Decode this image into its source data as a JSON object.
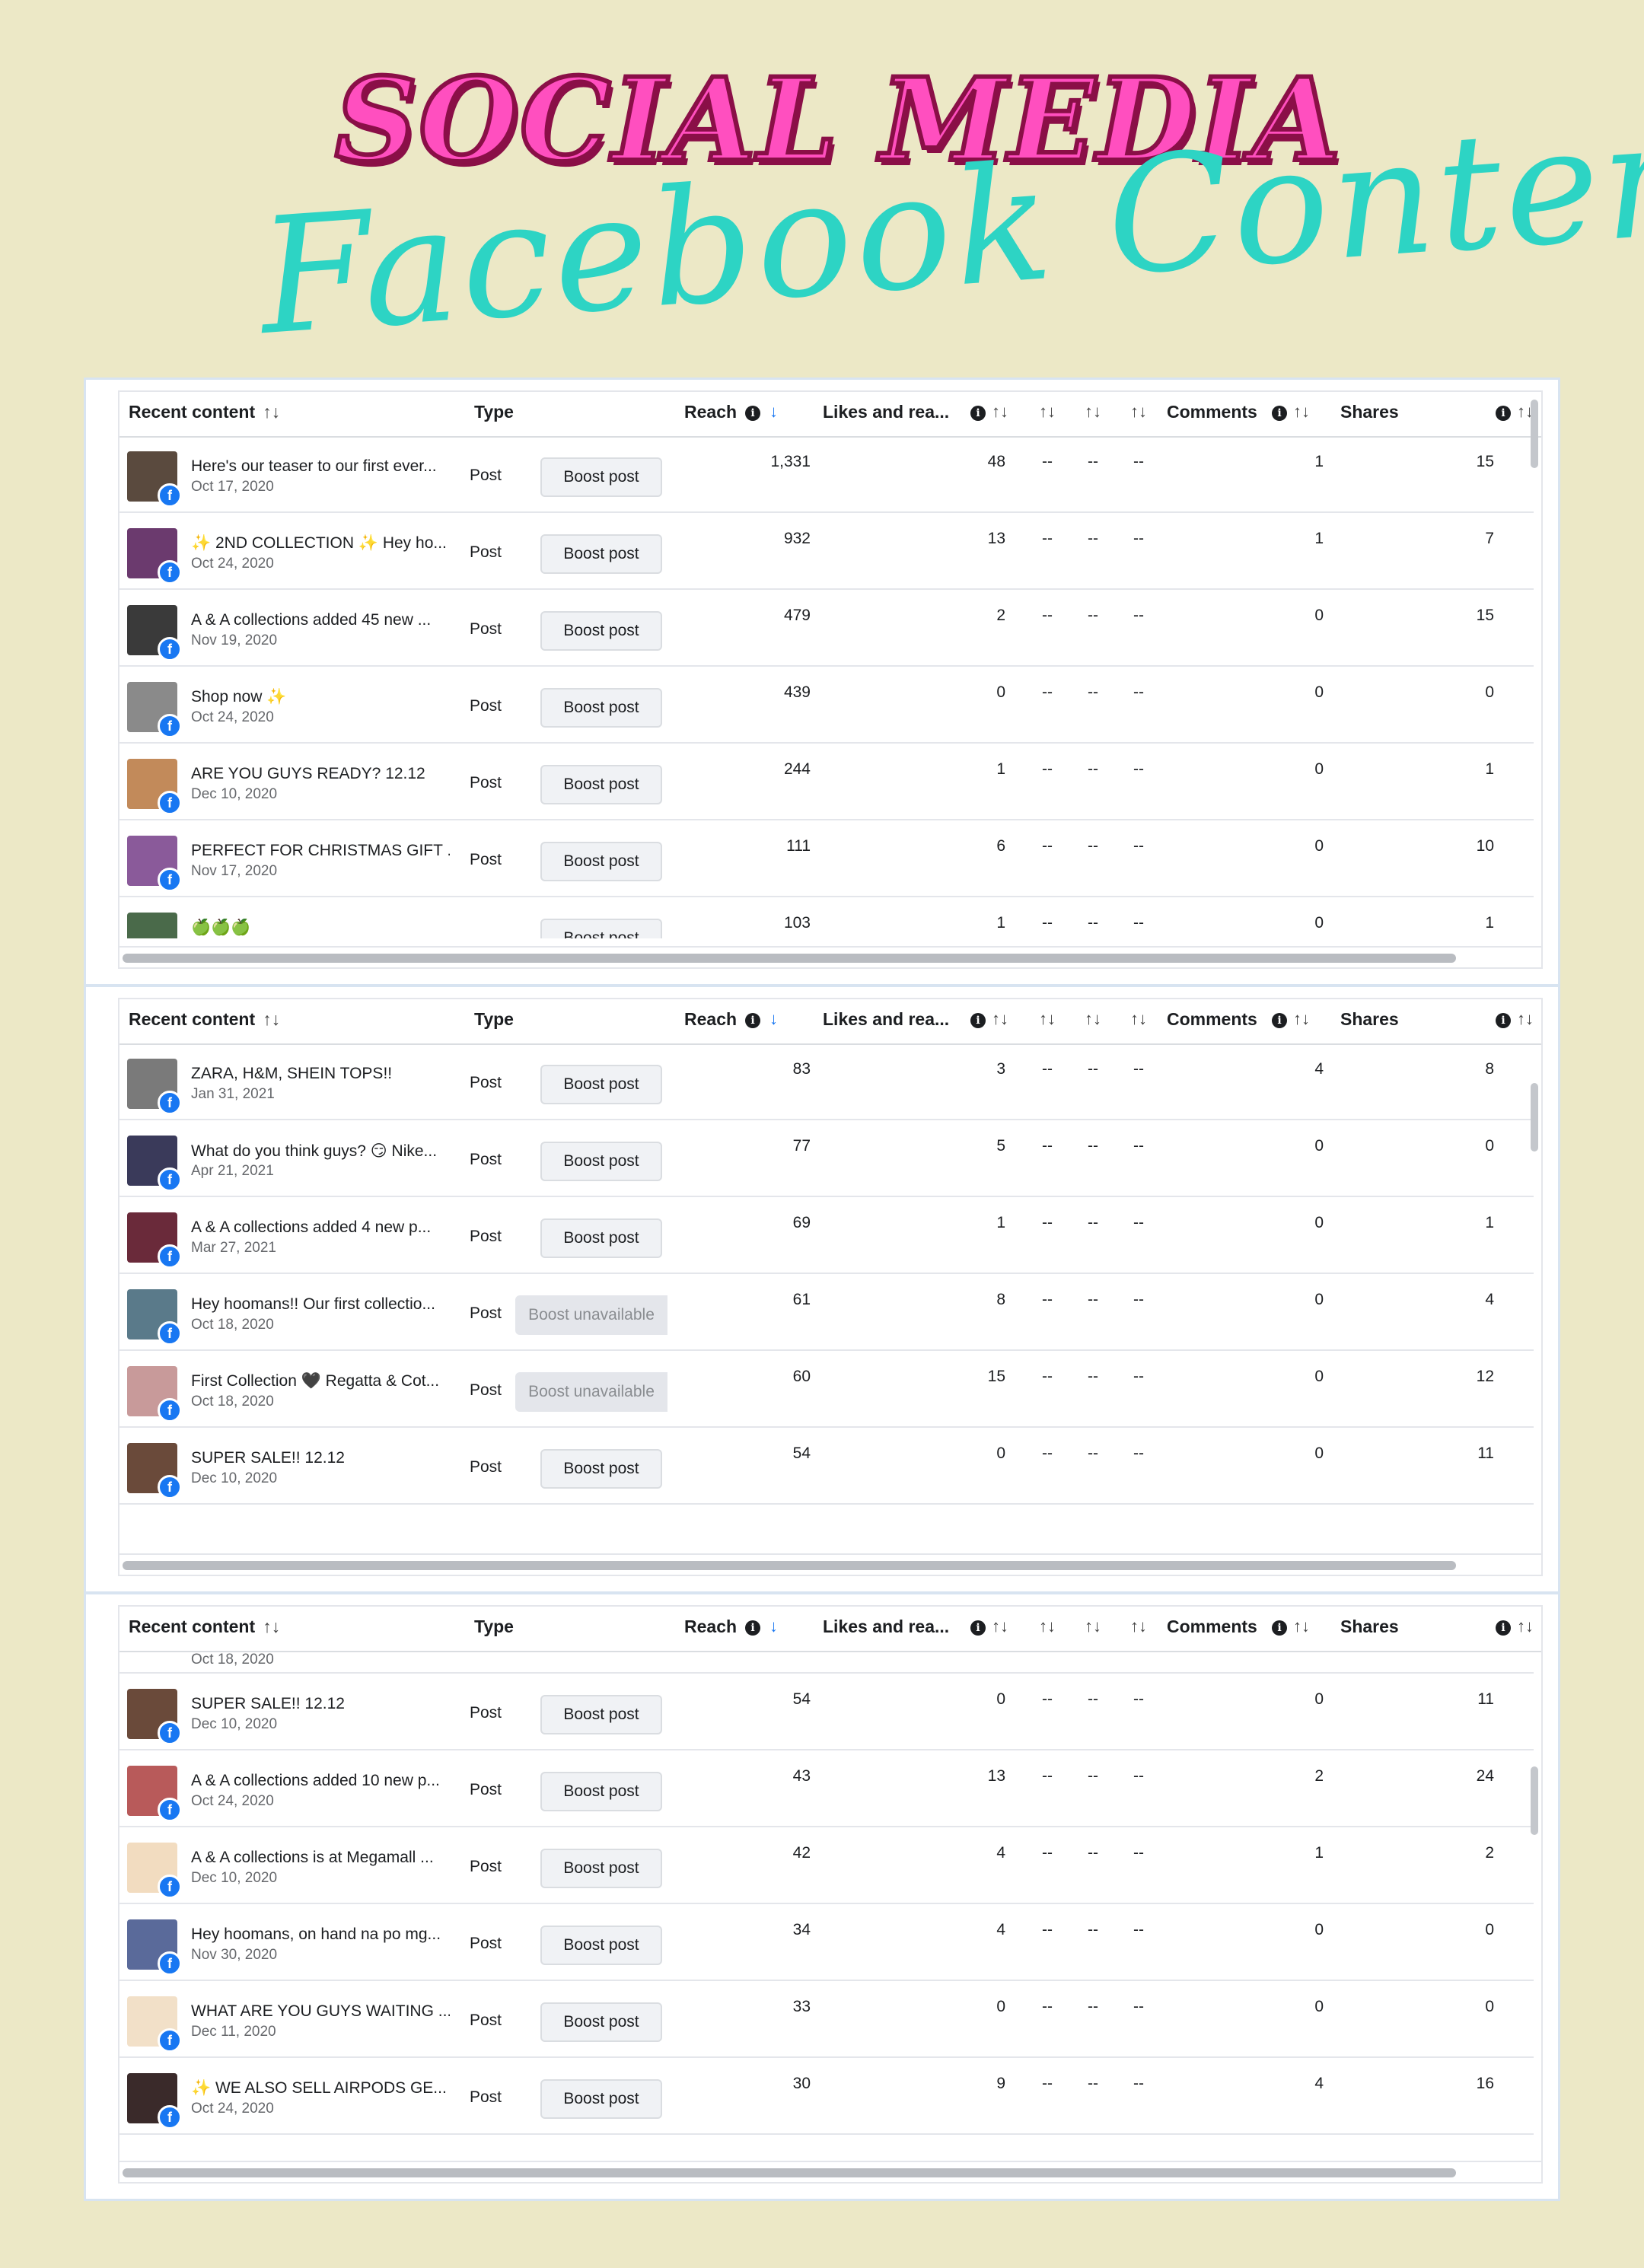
{
  "title": {
    "main": "SOCIAL MEDIA",
    "sub": "Facebook Contents"
  },
  "table_headers": {
    "recent_content": "Recent content",
    "type": "Type",
    "reach": "Reach",
    "likes": "Likes and rea...",
    "comments": "Comments",
    "shares": "Shares",
    "sort_glyph": "↑↓",
    "sort_down_glyph": "↓",
    "info_glyph": "i"
  },
  "dash": "--",
  "fb_glyph": "f",
  "panels": [
    {
      "rows": [
        {
          "title": "Here's our teaser to our first ever...",
          "date": "Oct 17, 2020",
          "type": "Post",
          "boost": "Boost post",
          "reach": "1,331",
          "likes": "48",
          "comments": "1",
          "shares": "15",
          "thumb": "#5a4a3e"
        },
        {
          "title": "✨ 2ND COLLECTION ✨ Hey ho...",
          "date": "Oct 24, 2020",
          "type": "Post",
          "boost": "Boost post",
          "reach": "932",
          "likes": "13",
          "comments": "1",
          "shares": "7",
          "thumb": "#6b3a6e"
        },
        {
          "title": "A & A collections added 45 new ...",
          "date": "Nov 19, 2020",
          "type": "Post",
          "boost": "Boost post",
          "reach": "479",
          "likes": "2",
          "comments": "0",
          "shares": "15",
          "thumb": "#3a3a3a"
        },
        {
          "title": "Shop now ✨",
          "date": "Oct 24, 2020",
          "type": "Post",
          "boost": "Boost post",
          "reach": "439",
          "likes": "0",
          "comments": "0",
          "shares": "0",
          "thumb": "#8a8a8a"
        },
        {
          "title": "ARE YOU GUYS READY? 12.12",
          "date": "Dec 10, 2020",
          "type": "Post",
          "boost": "Boost post",
          "reach": "244",
          "likes": "1",
          "comments": "0",
          "shares": "1",
          "thumb": "#c28a5a"
        },
        {
          "title": "PERFECT FOR CHRISTMAS GIFT ...",
          "date": "Nov 17, 2020",
          "type": "Post",
          "boost": "Boost post",
          "reach": "111",
          "likes": "6",
          "comments": "0",
          "shares": "10",
          "thumb": "#8a5a9a"
        },
        {
          "title": "🍏🍏🍏",
          "date": "",
          "type": "",
          "boost": "Boost post",
          "reach": "103",
          "likes": "1",
          "comments": "0",
          "shares": "1",
          "thumb": "#4a6a4a"
        }
      ]
    },
    {
      "rows": [
        {
          "title": "ZARA, H&M, SHEIN TOPS!!",
          "date": "Jan 31, 2021",
          "type": "Post",
          "boost": "Boost post",
          "reach": "83",
          "likes": "3",
          "comments": "4",
          "shares": "8",
          "thumb": "#7a7a7a"
        },
        {
          "title": "What do you think guys? 😏 Nike...",
          "date": "Apr 21, 2021",
          "type": "Post",
          "boost": "Boost post",
          "reach": "77",
          "likes": "5",
          "comments": "0",
          "shares": "0",
          "thumb": "#3a3a5a"
        },
        {
          "title": "A & A collections added 4 new p...",
          "date": "Mar 27, 2021",
          "type": "Post",
          "boost": "Boost post",
          "reach": "69",
          "likes": "1",
          "comments": "0",
          "shares": "1",
          "thumb": "#6a2a3a"
        },
        {
          "title": "Hey hoomans!! Our first collectio...",
          "date": "Oct 18, 2020",
          "type": "Post",
          "boost": "Boost unavailable",
          "reach": "61",
          "likes": "8",
          "comments": "0",
          "shares": "4",
          "thumb": "#5a7a8a"
        },
        {
          "title": "First Collection 🖤 Regatta & Cot...",
          "date": "Oct 18, 2020",
          "type": "Post",
          "boost": "Boost unavailable",
          "reach": "60",
          "likes": "15",
          "comments": "0",
          "shares": "12",
          "thumb": "#c89a9a"
        },
        {
          "title": "SUPER SALE!! 12.12",
          "date": "Dec 10, 2020",
          "type": "Post",
          "boost": "Boost post",
          "reach": "54",
          "likes": "0",
          "comments": "0",
          "shares": "11",
          "thumb": "#6a4a3a"
        }
      ]
    },
    {
      "partial_date": "Oct 18, 2020",
      "rows": [
        {
          "title": "SUPER SALE!! 12.12",
          "date": "Dec 10, 2020",
          "type": "Post",
          "boost": "Boost post",
          "reach": "54",
          "likes": "0",
          "comments": "0",
          "shares": "11",
          "thumb": "#6a4a3a"
        },
        {
          "title": "A & A collections added 10 new p...",
          "date": "Oct 24, 2020",
          "type": "Post",
          "boost": "Boost post",
          "reach": "43",
          "likes": "13",
          "comments": "2",
          "shares": "24",
          "thumb": "#b85a5a"
        },
        {
          "title": "A & A collections is at Megamall ...",
          "date": "Dec 10, 2020",
          "type": "Post",
          "boost": "Boost post",
          "reach": "42",
          "likes": "4",
          "comments": "1",
          "shares": "2",
          "thumb": "#f2dcc0"
        },
        {
          "title": "Hey hoomans, on hand na po mg...",
          "date": "Nov 30, 2020",
          "type": "Post",
          "boost": "Boost post",
          "reach": "34",
          "likes": "4",
          "comments": "0",
          "shares": "0",
          "thumb": "#5a6a9a"
        },
        {
          "title": "WHAT ARE YOU GUYS WAITING ...",
          "date": "Dec 11, 2020",
          "type": "Post",
          "boost": "Boost post",
          "reach": "33",
          "likes": "0",
          "comments": "0",
          "shares": "0",
          "thumb": "#f2e0c8"
        },
        {
          "title": "✨ WE ALSO SELL AIRPODS GE...",
          "date": "Oct 24, 2020",
          "type": "Post",
          "boost": "Boost post",
          "reach": "30",
          "likes": "9",
          "comments": "4",
          "shares": "16",
          "thumb": "#3a2a2a"
        }
      ]
    }
  ]
}
